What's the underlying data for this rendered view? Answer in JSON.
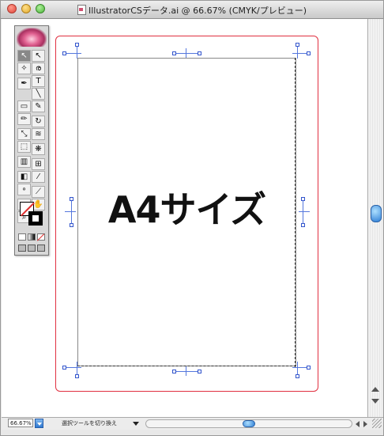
{
  "window": {
    "title": "IllustratorCSデータ.ai @ 66.67% (CMYK/プレビュー)"
  },
  "artboard": {
    "main_text": "A4サイズ"
  },
  "status": {
    "zoom": "66.67%",
    "tool_status": "選択ツールを切り換え"
  },
  "tools": {
    "items": [
      {
        "name": "selection-tool-icon",
        "glyph": "↖",
        "selected": true
      },
      {
        "name": "direct-selection-tool-icon",
        "glyph": "↖",
        "selected": false
      },
      {
        "name": "magic-wand-tool-icon",
        "glyph": "✧",
        "selected": false
      },
      {
        "name": "lasso-tool-icon",
        "glyph": "ര",
        "selected": false
      },
      {
        "name": "pen-tool-icon",
        "glyph": "✒",
        "selected": false
      },
      {
        "name": "type-tool-icon",
        "glyph": "T",
        "selected": false
      },
      {
        "name": "line-tool-icon",
        "glyph": "╲",
        "selected": false
      },
      {
        "name": "rectangle-tool-icon",
        "glyph": "▭",
        "selected": false
      },
      {
        "name": "paintbrush-tool-icon",
        "glyph": "✎",
        "selected": false
      },
      {
        "name": "pencil-tool-icon",
        "glyph": "✏",
        "selected": false
      },
      {
        "name": "rotate-tool-icon",
        "glyph": "↻",
        "selected": false
      },
      {
        "name": "scale-tool-icon",
        "glyph": "⤡",
        "selected": false
      },
      {
        "name": "warp-tool-icon",
        "glyph": "≋",
        "selected": false
      },
      {
        "name": "free-transform-tool-icon",
        "glyph": "⬚",
        "selected": false
      },
      {
        "name": "symbol-sprayer-tool-icon",
        "glyph": "❋",
        "selected": false
      },
      {
        "name": "graph-tool-icon",
        "glyph": "▥",
        "selected": false
      },
      {
        "name": "mesh-tool-icon",
        "glyph": "⊞",
        "selected": false
      },
      {
        "name": "gradient-tool-icon",
        "glyph": "◧",
        "selected": false
      },
      {
        "name": "eyedropper-tool-icon",
        "glyph": "⁄",
        "selected": false
      },
      {
        "name": "blend-tool-icon",
        "glyph": "∘",
        "selected": false
      },
      {
        "name": "slice-tool-icon",
        "glyph": "⟋",
        "selected": false
      },
      {
        "name": "scissors-tool-icon",
        "glyph": "✂",
        "selected": false
      },
      {
        "name": "hand-tool-icon",
        "glyph": "✋",
        "selected": false
      },
      {
        "name": "zoom-tool-icon",
        "glyph": "⌕",
        "selected": false
      }
    ]
  },
  "colors": {
    "bleed_border": "#e03040",
    "trim_marks": "#3355cc",
    "scroll_thumb": "#2f7fd6"
  }
}
